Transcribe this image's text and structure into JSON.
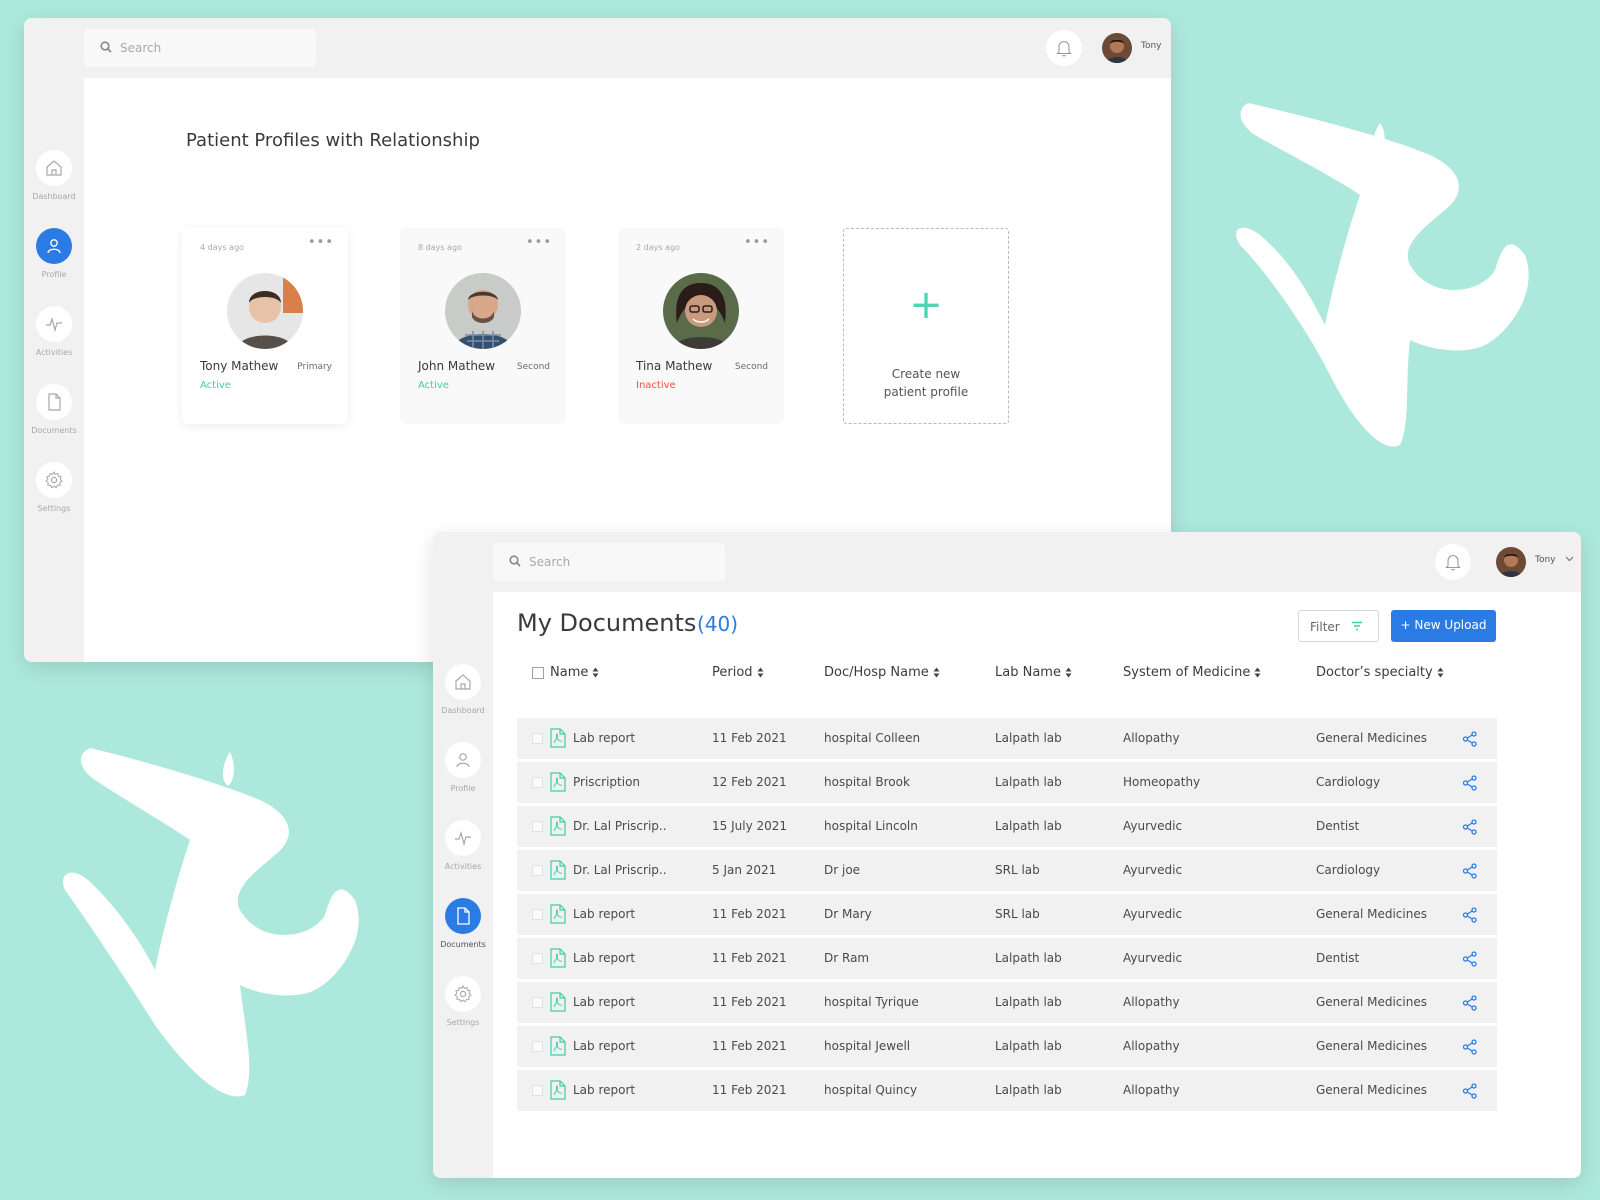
{
  "colors": {
    "background": "#ace9dc",
    "accent_blue": "#2b7be4",
    "active_green": "#3ccfa8",
    "inactive_red": "#e9503e",
    "plus_teal": "#4ed4b4"
  },
  "profiles_window": {
    "search": {
      "placeholder": "Search"
    },
    "user": {
      "name": "Tony"
    },
    "nav": [
      {
        "label": "Dashboard",
        "icon": "home-icon",
        "active": false
      },
      {
        "label": "Profile",
        "icon": "user-icon",
        "active": true
      },
      {
        "label": "Activities",
        "icon": "activity-icon",
        "active": false
      },
      {
        "label": "Documents",
        "icon": "document-icon",
        "active": false
      },
      {
        "label": "Settings",
        "icon": "gear-icon",
        "active": false
      }
    ],
    "title": "Patient Profiles with Relationship",
    "profiles": [
      {
        "age": "4 days ago",
        "name": "Tony Mathew",
        "relationship": "Primary",
        "status": "Active"
      },
      {
        "age": "8 days ago",
        "name": "John Mathew",
        "relationship": "Second",
        "status": "Active"
      },
      {
        "age": "2 days ago",
        "name": "Tina  Mathew",
        "relationship": "Second",
        "status": "Inactive"
      }
    ],
    "create_card": {
      "line1": "Create new",
      "line2": "patient profile"
    }
  },
  "documents_window": {
    "search": {
      "placeholder": "Search"
    },
    "user": {
      "name": "Tony"
    },
    "nav": [
      {
        "label": "Dashboard",
        "icon": "home-icon",
        "active": false
      },
      {
        "label": "Profile",
        "icon": "user-icon",
        "active": false
      },
      {
        "label": "Activities",
        "icon": "activity-icon",
        "active": false
      },
      {
        "label": "Documents",
        "icon": "document-icon",
        "active": true
      },
      {
        "label": "Settings",
        "icon": "gear-icon",
        "active": false
      }
    ],
    "title": "My Documents",
    "count": "(40)",
    "filter_label": "Filter",
    "upload_label": "+ New Upload",
    "columns": [
      "Name",
      "Period",
      "Doc/Hosp Name",
      "Lab Name",
      "System of Medicine",
      "Doctor’s specialty"
    ],
    "rows": [
      [
        "Lab report",
        "11 Feb 2021",
        "hospital Colleen",
        "Lalpath lab",
        "Allopathy",
        "General Medicines"
      ],
      [
        "Priscription",
        "12 Feb 2021",
        "hospital Brook",
        "Lalpath lab",
        "Homeopathy",
        "Cardiology"
      ],
      [
        "Dr. Lal Priscrip..",
        "15 July 2021",
        "hospital Lincoln",
        "Lalpath lab",
        "Ayurvedic",
        "Dentist"
      ],
      [
        "Dr. Lal Priscrip..",
        "5 Jan 2021",
        "Dr joe",
        "SRL lab",
        "Ayurvedic",
        "Cardiology"
      ],
      [
        "Lab report",
        "11 Feb 2021",
        "Dr Mary",
        "SRL lab",
        "Ayurvedic",
        "General Medicines"
      ],
      [
        "Lab report",
        "11 Feb 2021",
        "Dr Ram",
        "Lalpath lab",
        "Ayurvedic",
        "Dentist"
      ],
      [
        "Lab report",
        "11 Feb 2021",
        "hospital Tyrique",
        "Lalpath lab",
        "Allopathy",
        "General Medicines"
      ],
      [
        "Lab report",
        "11 Feb 2021",
        "hospital Jewell",
        "Lalpath lab",
        "Allopathy",
        "General Medicines"
      ],
      [
        "Lab report",
        "11 Feb 2021",
        "hospital Quincy",
        "Lalpath lab",
        "Allopathy",
        "General Medicines"
      ]
    ]
  }
}
